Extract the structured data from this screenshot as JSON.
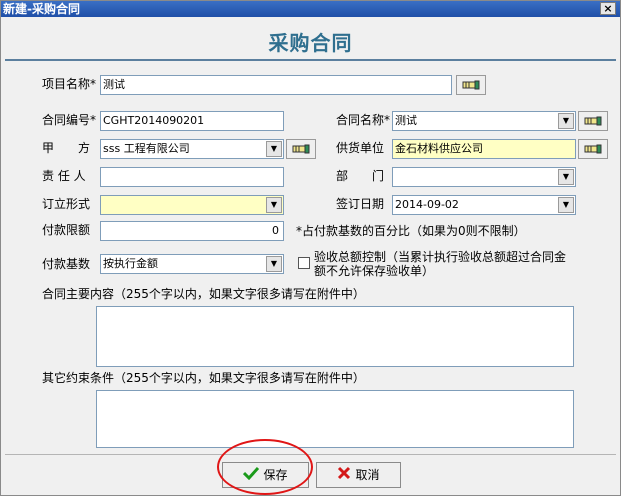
{
  "window": {
    "title": "新建-采购合同",
    "close_glyph": "×"
  },
  "form": {
    "title": "采购合同"
  },
  "fields": {
    "project_name": {
      "label": "项目名称*",
      "value": "测试"
    },
    "contract_no": {
      "label": "合同编号*",
      "value": "CGHT2014090201"
    },
    "contract_name": {
      "label": "合同名称*",
      "value": "测试"
    },
    "party_a": {
      "label": "甲　　方",
      "value": "sss 工程有限公司"
    },
    "supplier": {
      "label": "供货单位",
      "value": "金石材料供应公司"
    },
    "person": {
      "label": "责 任 人",
      "value": ""
    },
    "department": {
      "label": "部　　门",
      "value": ""
    },
    "form_type": {
      "label": "订立形式",
      "value": ""
    },
    "sign_date": {
      "label": "签订日期",
      "value": "2014-09-02"
    },
    "payment_limit": {
      "label": "付款限额",
      "value": "0",
      "hint": "*占付款基数的百分比（如果为0则不限制）"
    },
    "payment_base": {
      "label": "付款基数",
      "value": "按执行金额"
    },
    "acceptance_control": {
      "label": "验收总额控制（当累计执行验收总额超过合同金额不允许保存验收单）",
      "checked": false
    },
    "main_content": {
      "label": "合同主要内容（255个字以内，如果文字很多请写在附件中）",
      "value": ""
    },
    "other_terms": {
      "label": "其它约束条件（255个字以内，如果文字很多请写在附件中）",
      "value": ""
    }
  },
  "buttons": {
    "save": "保存",
    "cancel": "取消"
  },
  "colors": {
    "required_highlight": "#ffffc4",
    "title": "#2f6f8f",
    "annotation_circle": "#e01616"
  }
}
